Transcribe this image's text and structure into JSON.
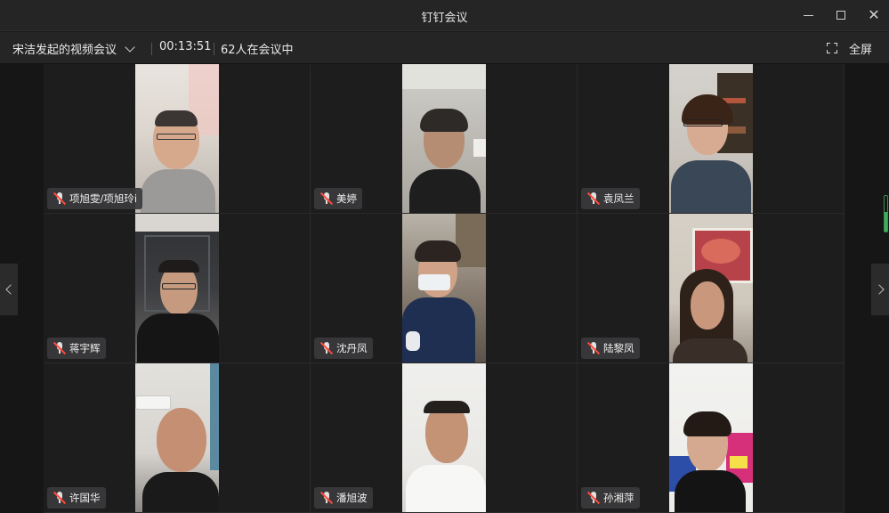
{
  "window": {
    "title": "钉钉会议"
  },
  "meeting": {
    "name": "宋洁发起的视频会议",
    "elapsed": "00:13:51",
    "participants": "62人在会议中",
    "fullscreen_label": "全屏"
  },
  "tiles": [
    {
      "name": "项旭雯/项旭玲i"
    },
    {
      "name": "美婷"
    },
    {
      "name": "袁凤兰"
    },
    {
      "name": "蒋宇辉"
    },
    {
      "name": "沈丹凤"
    },
    {
      "name": "陆黎凤"
    },
    {
      "name": "许国华"
    },
    {
      "name": "潘旭波"
    },
    {
      "name": "孙湘萍"
    }
  ],
  "speaking_level": 0.55
}
